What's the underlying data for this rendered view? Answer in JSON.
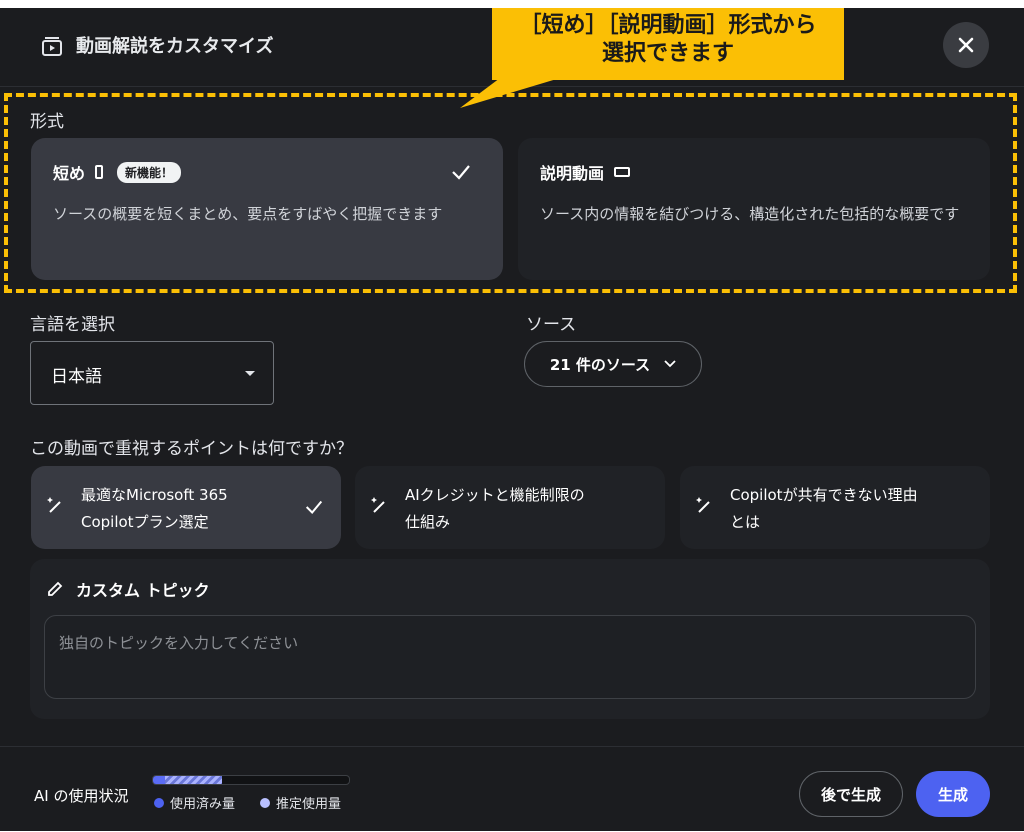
{
  "header": {
    "title": "動画解説をカスタマイズ",
    "icon": "video-frame-icon",
    "close_icon": "close-icon"
  },
  "callout": {
    "line1": "［短め］［説明動画］形式から",
    "line2": "選択できます",
    "color": "#fbbf05"
  },
  "format": {
    "label": "形式",
    "cards": [
      {
        "title": "短め",
        "badge": "新機能！",
        "desc": "ソースの概要を短くまとめ、要点をすばやく把握できます",
        "selected": true,
        "icon": "portrait-icon"
      },
      {
        "title": "説明動画",
        "desc": "ソース内の情報を結びつける、構造化された包括的な概要です",
        "selected": false,
        "icon": "landscape-icon"
      }
    ]
  },
  "language": {
    "label": "言語を選択",
    "value": "日本語"
  },
  "source": {
    "label": "ソース",
    "button": "21 件のソース"
  },
  "points": {
    "label": "この動画で重視するポイントは何ですか？",
    "items": [
      {
        "line1": "最適なMicrosoft 365",
        "line2": "Copilotプラン選定",
        "selected": true
      },
      {
        "line1": "AIクレジットと機能制限の",
        "line2": "仕組み",
        "selected": false
      },
      {
        "line1": "Copilotが共有できない理由",
        "line2": "とは",
        "selected": false
      }
    ]
  },
  "custom": {
    "title": "カスタム トピック",
    "placeholder": "独自のトピックを入力してください"
  },
  "footer": {
    "usage_label": "AI の使用状況",
    "legend_used": "使用済み量",
    "legend_estimated": "推定使用量",
    "used_fraction": 0.06,
    "estimated_fraction": 0.35,
    "later_button": "後で生成",
    "generate_button": "生成",
    "accent": "#4d62f1"
  }
}
